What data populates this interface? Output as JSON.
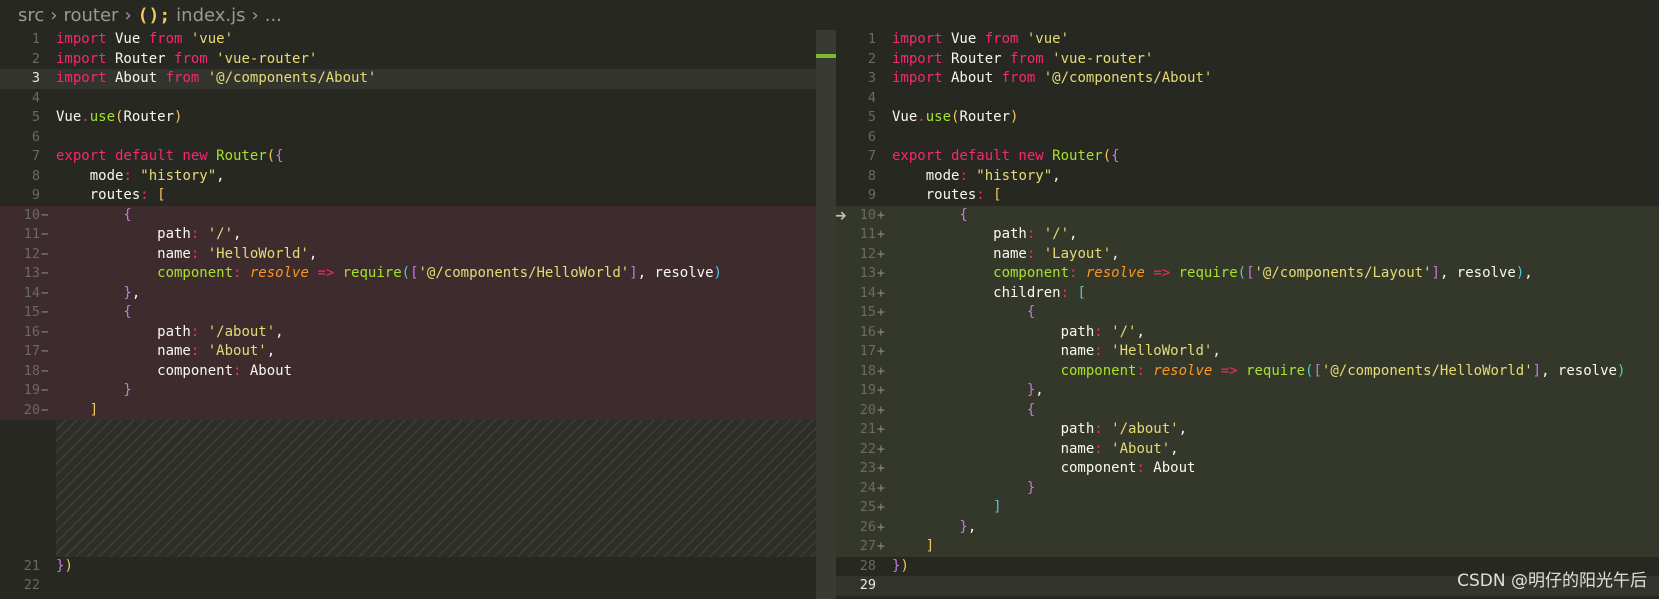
{
  "breadcrumb": {
    "items": [
      "src",
      "router",
      "index.js",
      "..."
    ],
    "file_icon": "(); "
  },
  "watermark": "CSDN @明仔的阳光午后",
  "left": {
    "lines": [
      {
        "n": "1"
      },
      {
        "n": "2"
      },
      {
        "n": "3"
      },
      {
        "n": "4"
      },
      {
        "n": "5"
      },
      {
        "n": "6"
      },
      {
        "n": "7"
      },
      {
        "n": "8"
      },
      {
        "n": "9"
      },
      {
        "n": "10"
      },
      {
        "n": "11"
      },
      {
        "n": "12"
      },
      {
        "n": "13"
      },
      {
        "n": "14"
      },
      {
        "n": "15"
      },
      {
        "n": "16"
      },
      {
        "n": "17"
      },
      {
        "n": "18"
      },
      {
        "n": "19"
      },
      {
        "n": "20"
      },
      {
        "n": "21"
      },
      {
        "n": "22"
      }
    ]
  },
  "right": {
    "lines": [
      {
        "n": "1"
      },
      {
        "n": "2"
      },
      {
        "n": "3"
      },
      {
        "n": "4"
      },
      {
        "n": "5"
      },
      {
        "n": "6"
      },
      {
        "n": "7"
      },
      {
        "n": "8"
      },
      {
        "n": "9"
      },
      {
        "n": "10"
      },
      {
        "n": "11"
      },
      {
        "n": "12"
      },
      {
        "n": "13"
      },
      {
        "n": "14"
      },
      {
        "n": "15"
      },
      {
        "n": "16"
      },
      {
        "n": "17"
      },
      {
        "n": "18"
      },
      {
        "n": "19"
      },
      {
        "n": "20"
      },
      {
        "n": "21"
      },
      {
        "n": "22"
      },
      {
        "n": "23"
      },
      {
        "n": "24"
      },
      {
        "n": "25"
      },
      {
        "n": "26"
      },
      {
        "n": "27"
      },
      {
        "n": "28"
      },
      {
        "n": "29"
      }
    ]
  },
  "code": {
    "imp_vue": "import Vue from 'vue'",
    "imp_router": "import Router from 'vue-router'",
    "imp_about": "import About from '@/components/About'",
    "vue_use": "Vue.use(Router)",
    "export_line": "export default new Router({",
    "mode_line": "mode: \"history\",",
    "routes_line": "routes: [",
    "end_line": "})",
    "left_removed": [
      "{",
      "path: '/',",
      "name: 'HelloWorld',",
      "component: resolve => require(['@/components/HelloWorld'], resolve)",
      "},",
      "{",
      "path: '/about',",
      "name: 'About',",
      "component: About",
      "}",
      "]"
    ],
    "right_added": [
      "{",
      "path: '/',",
      "name: 'Layout',",
      "component: resolve => require(['@/components/Layout'], resolve),",
      "children: [",
      "{",
      "path: '/',",
      "name: 'HelloWorld',",
      "component: resolve => require(['@/components/HelloWorld'], resolve)",
      "},",
      "{",
      "path: '/about',",
      "name: 'About',",
      "component: About",
      "}",
      "]",
      "},",
      "]"
    ]
  },
  "colors": {
    "background": "#272822",
    "keyword": "#f92672",
    "string": "#e6db74",
    "function": "#a6e22e",
    "param": "#fd971f",
    "removed_bg": "#3d2b2e",
    "added_bg": "#34382a"
  }
}
